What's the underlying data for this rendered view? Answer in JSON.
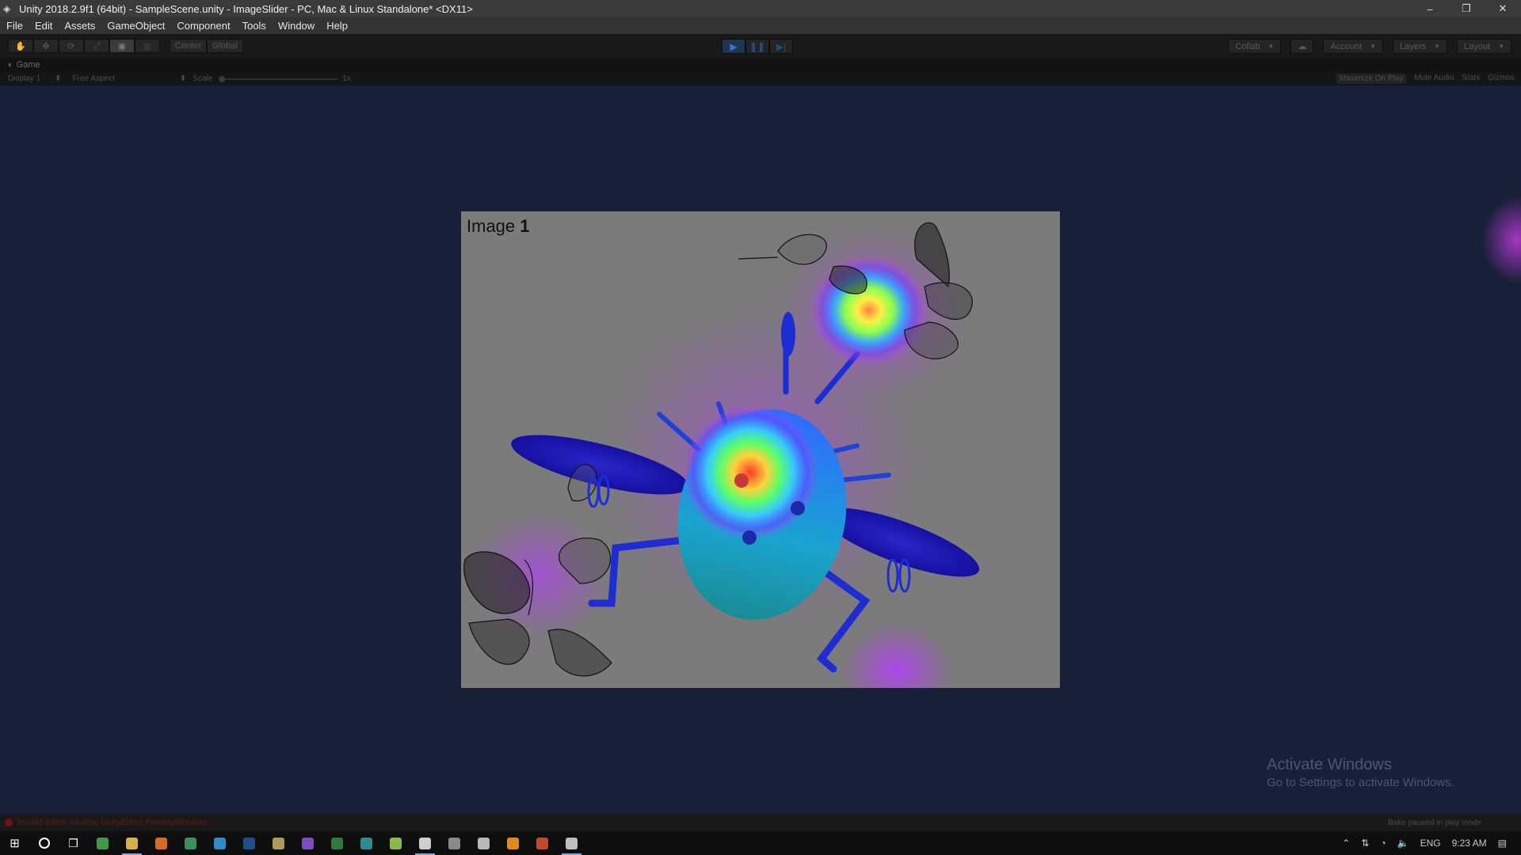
{
  "window": {
    "title": "Unity 2018.2.9f1 (64bit) - SampleScene.unity - ImageSlider - PC, Mac & Linux Standalone* <DX11>",
    "minimize": "–",
    "restore": "❐",
    "close": "✕"
  },
  "menu": [
    "File",
    "Edit",
    "Assets",
    "GameObject",
    "Component",
    "Tools",
    "Window",
    "Help"
  ],
  "toolbar": {
    "tools": [
      "✋",
      "✥",
      "⟳",
      "⤢",
      "▣",
      "◎"
    ],
    "pivot": "Center",
    "space": "Global",
    "play": "▶",
    "pause": "❚❚",
    "step": "▶|",
    "collab": "Collab",
    "account": "Account",
    "layers": "Layers",
    "layout": "Layout"
  },
  "game_tab": {
    "label": "Game",
    "display": "Display 1",
    "aspect": "Free Aspect",
    "scale_label": "Scale",
    "scale_value": "1x",
    "maximize": "Maximize On Play",
    "mute": "Mute Audio",
    "stats": "Stats",
    "gizmos": "Gizmos"
  },
  "image_card": {
    "label_prefix": "Image",
    "label_number": "1"
  },
  "watermark": {
    "line1": "Activate Windows",
    "line2": "Go to Settings to activate Windows."
  },
  "status": {
    "error": "Invalid editor window UnityEditor.PreviewWindow",
    "right": "Bake paused in play mode"
  },
  "taskbar": {
    "apps": [
      {
        "name": "chrome",
        "color": "#3f9a48"
      },
      {
        "name": "file-explorer",
        "color": "#d7b04a"
      },
      {
        "name": "firefox",
        "color": "#d56a25"
      },
      {
        "name": "edge",
        "color": "#3a8f5a"
      },
      {
        "name": "telegram",
        "color": "#2e8bc6"
      },
      {
        "name": "photoshop",
        "color": "#1d4f8a"
      },
      {
        "name": "notes",
        "color": "#b09a5a"
      },
      {
        "name": "visual-studio",
        "color": "#7a4fbd"
      },
      {
        "name": "excel-like",
        "color": "#2d7a3c"
      },
      {
        "name": "arduino",
        "color": "#2c8c93"
      },
      {
        "name": "tool",
        "color": "#8cb84a"
      },
      {
        "name": "unity",
        "color": "#cfcfcf"
      },
      {
        "name": "app-a",
        "color": "#8a8a8a"
      },
      {
        "name": "app-b",
        "color": "#b8b8b8"
      },
      {
        "name": "blender",
        "color": "#e58a1a"
      },
      {
        "name": "powerpoint",
        "color": "#c4482a"
      },
      {
        "name": "unity-2",
        "color": "#bfbfbf"
      }
    ],
    "lang": "ENG",
    "time": "9:23 AM"
  }
}
